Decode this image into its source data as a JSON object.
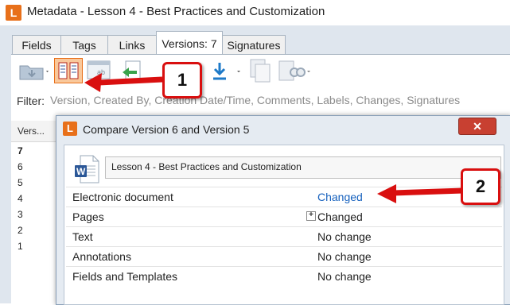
{
  "window": {
    "app_icon_letter": "L",
    "title": "Metadata - Lesson 4 - Best Practices and Customization"
  },
  "tabs": [
    {
      "label": "Fields",
      "active": false
    },
    {
      "label": "Tags",
      "active": false
    },
    {
      "label": "Links",
      "active": false
    },
    {
      "label": "Versions: 7",
      "active": true
    },
    {
      "label": "Signatures",
      "active": false
    }
  ],
  "filter": {
    "label": "Filter:",
    "placeholder": "Version, Created By, Creation Date/Time, Comments, Labels, Changes, Signatures"
  },
  "versions_list": {
    "header": "Vers...",
    "rows": [
      "7",
      "6",
      "5",
      "4",
      "3",
      "2",
      "1"
    ]
  },
  "dialog": {
    "icon_letter": "L",
    "title": "Compare Version 6 and Version 5",
    "close_label": "✕",
    "document_name": "Lesson 4 - Best Practices and Customization",
    "comparisons": [
      {
        "label": "Electronic document",
        "value": "Changed"
      },
      {
        "label": "Pages",
        "value": "Changed"
      },
      {
        "label": "Text",
        "value": "No change"
      },
      {
        "label": "Annotations",
        "value": "No change"
      },
      {
        "label": "Fields and Templates",
        "value": "No change"
      }
    ]
  },
  "callouts": [
    "1",
    "2"
  ],
  "colors": {
    "accent_orange": "#e8701a",
    "link_blue": "#1560bd",
    "callout_red": "#d90f0f"
  }
}
